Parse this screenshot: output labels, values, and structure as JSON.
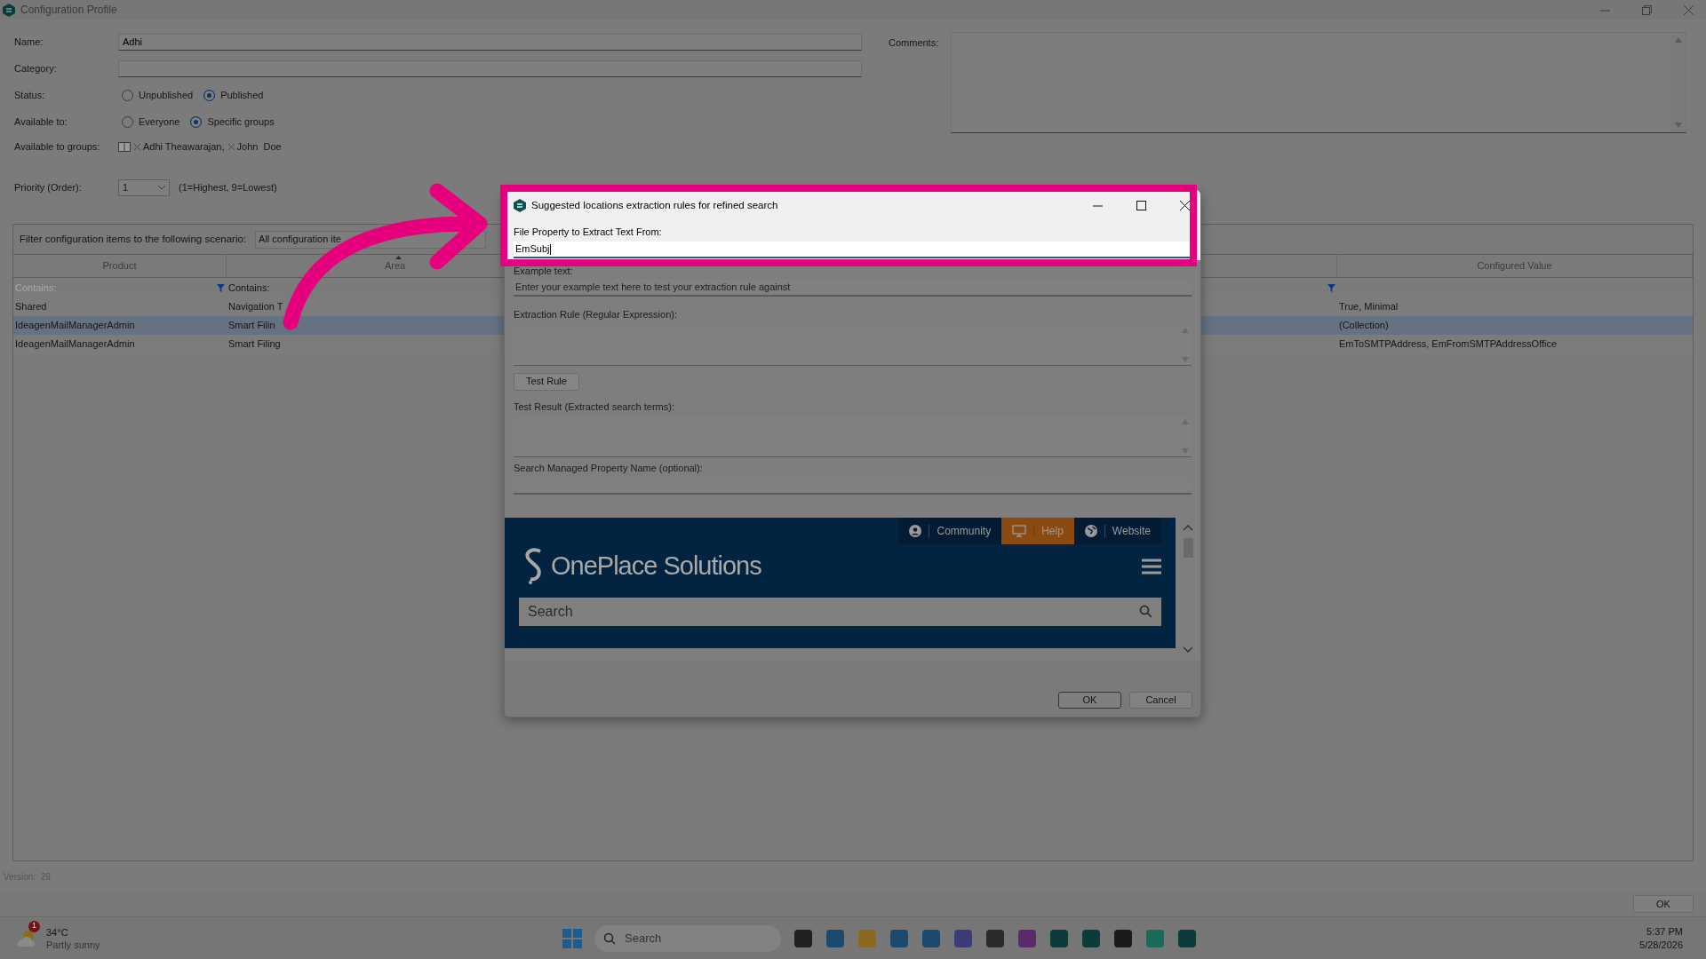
{
  "window": {
    "title": "Configuration Profile"
  },
  "form": {
    "name": {
      "label": "Name:",
      "value": "Adhi"
    },
    "category": {
      "label": "Category:"
    },
    "status": {
      "label": "Status:",
      "options": [
        {
          "label": "Unpublished",
          "selected": false
        },
        {
          "label": "Published",
          "selected": true
        }
      ]
    },
    "available_to": {
      "label": "Available to:",
      "options": [
        {
          "label": "Everyone",
          "selected": false
        },
        {
          "label": "Specific groups",
          "selected": true
        }
      ]
    },
    "groups": {
      "label": "Available to groups:",
      "members": [
        "Adhi Theawarajan,",
        "John  Doe"
      ]
    },
    "priority": {
      "label": "Priority (Order):",
      "value": "1",
      "hint": "(1=Highest, 9=Lowest)"
    },
    "comments": {
      "label": "Comments:"
    }
  },
  "filter": {
    "label": "Filter configuration items to the following scenario:",
    "value": "All configuration ite"
  },
  "table": {
    "columns": [
      {
        "label": "Product",
        "filter_placeholder": "Contains:",
        "sorted": false
      },
      {
        "label": "Area",
        "filter": "Contains:",
        "sorted": true
      },
      {
        "label": "Configured Value",
        "sorted": false
      }
    ],
    "rows": [
      {
        "cells": [
          "Shared",
          "Navigation T",
          "True, Minimal"
        ],
        "selected": false
      },
      {
        "cells": [
          "IdeagenMailManagerAdmin",
          "Smart Filin",
          "(Collection)"
        ],
        "selected": true
      },
      {
        "cells": [
          "IdeagenMailManagerAdmin",
          "Smart Filing",
          "EmToSMTPAddress, EmFromSMTPAddressOffice"
        ],
        "selected": false
      }
    ]
  },
  "version": "Version:  29",
  "ok_button": "OK",
  "dialog": {
    "title": "Suggested locations extraction rules for refined search",
    "fields": [
      {
        "kind": "input",
        "label": "File Property to Extract Text From:",
        "value": "EmSubj",
        "highlighted": true
      },
      {
        "kind": "input",
        "label": "Example text:",
        "placeholder": "Enter your example text here to test your extraction rule against",
        "highlighted": false
      },
      {
        "kind": "textarea",
        "label": "Extraction Rule (Regular Expression):",
        "highlighted": false
      },
      {
        "kind": "button",
        "label": "Test Rule",
        "highlighted": false
      },
      {
        "kind": "textarea",
        "label": "Test Result (Extracted search terms):",
        "highlighted": false
      },
      {
        "kind": "input",
        "label": "Search Managed Property Name (optional):",
        "highlighted": false
      }
    ],
    "web": {
      "links": [
        {
          "label": "Community",
          "selected": false
        },
        {
          "label": "Help",
          "selected": true
        },
        {
          "label": "Website",
          "selected": false
        }
      ],
      "logo": "OnePlace Solutions",
      "search_placeholder": "Search"
    },
    "buttons": [
      "OK",
      "Cancel"
    ]
  },
  "taskbar": {
    "weather": {
      "temp": "34°C",
      "text": "Partly sunny",
      "badge": "1"
    },
    "search": "Search",
    "time": "5:37 PM",
    "date": "5/28/2026"
  }
}
